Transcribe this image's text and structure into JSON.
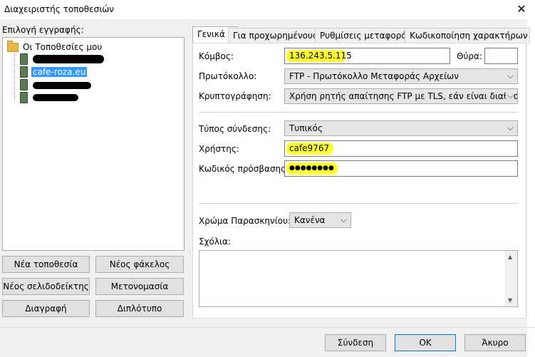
{
  "window": {
    "title": "Διαχειριστής τοποθεσιών",
    "close_glyph": "✕"
  },
  "left": {
    "label": "Επιλογή εγγραφής:",
    "root_label": "Οι Τοποθεσίες μου",
    "sites": [
      {
        "label": "",
        "redacted": true
      },
      {
        "label": "cafe-roza.eu",
        "selected": true
      },
      {
        "label": "",
        "redacted": true
      },
      {
        "label": "",
        "redacted": true
      }
    ],
    "buttons": {
      "new_site": "Νέα τοποθεσία",
      "new_folder": "Νέος φάκελος",
      "new_bookmark": "Νέος σελιδοδείκτης",
      "rename": "Μετονομασία",
      "delete": "Διαγραφή",
      "duplicate": "Διπλότυπο"
    }
  },
  "tabs": [
    "Γενικά",
    "Για προχωρημένους",
    "Ρυθμίσεις μεταφοράς",
    "Κωδικοποίηση χαρακτήρων"
  ],
  "general": {
    "host_label": "Κόμβος:",
    "host_value": "136.243.5.115",
    "port_label": "Θύρα:",
    "port_value": "",
    "protocol_label": "Πρωτόκολλο:",
    "protocol_value": "FTP - Πρωτόκολλο Μεταφοράς Αρχείων",
    "encryption_label": "Κρυπτογράφηση:",
    "encryption_value": "Χρήση ρητής απαίτησης FTP με TLS, εάν είναι διαθέσιμη",
    "logon_label": "Τύπος σύνδεσης:",
    "logon_value": "Τυπικός",
    "user_label": "Χρήστης:",
    "user_value": "cafe9767",
    "password_label": "Κωδικός πρόσβασης:",
    "password_value": "●●●●●●●●",
    "bgcolor_label": "Χρώμα Παρασκηνίου:",
    "bgcolor_value": "Κανένα",
    "comments_label": "Σχόλια:"
  },
  "footer": {
    "connect": "Σύνδεση",
    "ok": "OK",
    "cancel": "Άκυρο"
  },
  "colors": {
    "highlight": "#ffff33",
    "selection": "#3399ff",
    "default_border": "#0078d7"
  }
}
